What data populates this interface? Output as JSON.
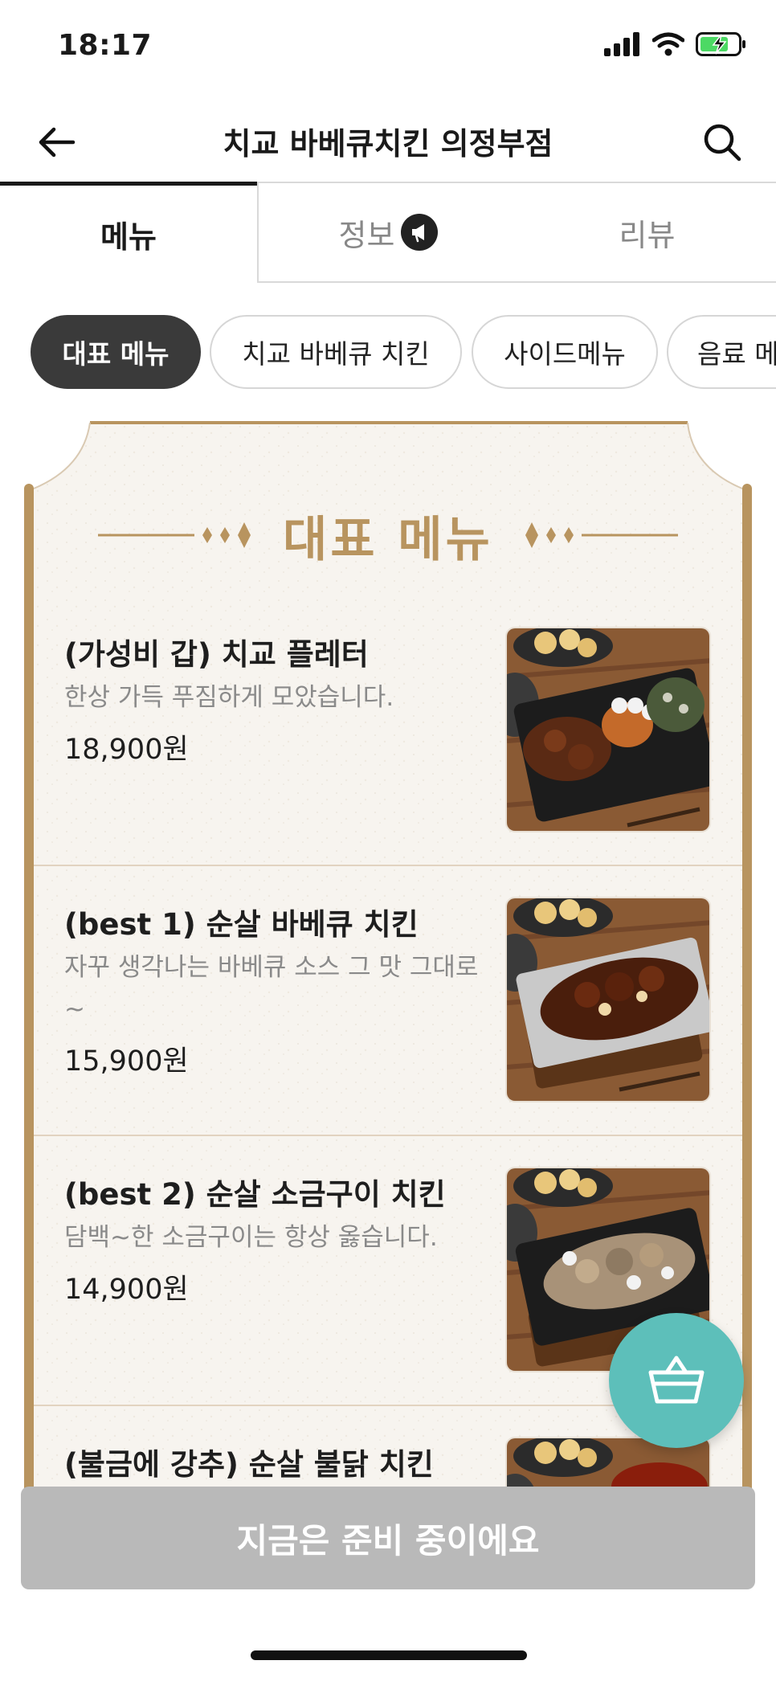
{
  "status_bar": {
    "time": "18:17"
  },
  "header": {
    "title": "치교 바베큐치킨 의정부점",
    "back_icon": "arrow-left-icon",
    "search_icon": "search-icon"
  },
  "tabs": [
    {
      "label": "메뉴",
      "active": true
    },
    {
      "label": "정보",
      "badge_icon": "megaphone-icon"
    },
    {
      "label": "리뷰"
    }
  ],
  "categories": [
    {
      "label": "대표 메뉴",
      "active": true
    },
    {
      "label": "치교 바베큐 치킨"
    },
    {
      "label": "사이드메뉴"
    },
    {
      "label": "음료 메뉴"
    }
  ],
  "board": {
    "title": "대표 메뉴",
    "accent_color": "#b8945f",
    "items": [
      {
        "name": "(가성비 갑) 치교  플레터",
        "desc": "한상 가득 푸짐하게 모았습니다.",
        "price": "18,900원"
      },
      {
        "name": "(best 1) 순살 바베큐 치킨",
        "desc": "자꾸 생각나는 바베큐 소스 그 맛 그대로~",
        "price": "15,900원"
      },
      {
        "name": "(best 2) 순살 소금구이 치킨",
        "desc": "담백~한 소금구이는 항상 옳습니다.",
        "price": "14,900원"
      },
      {
        "name": "(불금에 강추) 순살 불닭 치킨",
        "desc": "",
        "price": ""
      }
    ]
  },
  "cart": {
    "icon": "basket-icon",
    "color": "#5dbfba"
  },
  "order_button": {
    "label": "지금은 준비 중이에요"
  }
}
